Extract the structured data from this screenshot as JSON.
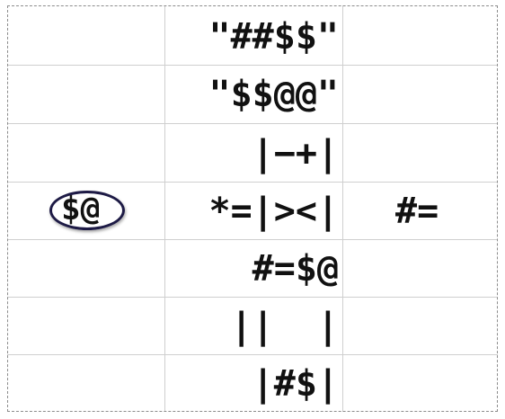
{
  "grid": {
    "rows": [
      {
        "left": "",
        "middle": "\"##$$\"",
        "right": ""
      },
      {
        "left": "",
        "middle": "\"$$@@\"",
        "right": ""
      },
      {
        "left": "",
        "middle": "|−+|",
        "right": ""
      },
      {
        "left": "$@",
        "middle": "*=|><|",
        "right": "#="
      },
      {
        "left": "",
        "middle": "#=$@",
        "right": ""
      },
      {
        "left": "",
        "middle": "||  |",
        "right": ""
      },
      {
        "left": "",
        "middle": "|#$|",
        "right": ""
      }
    ]
  },
  "colors": {
    "grid_line": "#cfcfcf",
    "frame": "#8c8c8c",
    "oval_border": "#1d1a45",
    "text": "#111111"
  }
}
